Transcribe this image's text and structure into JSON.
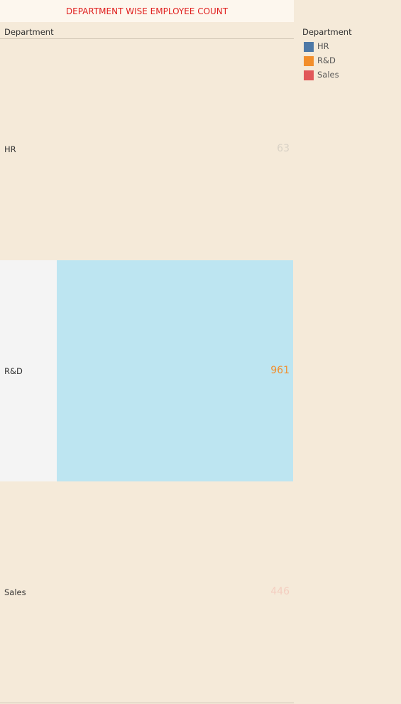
{
  "title": "DEPARTMENT WISE EMPLOYEE COUNT",
  "table": {
    "column_header": "Department",
    "rows": [
      {
        "label": "HR",
        "value": "63",
        "value_color": "#d9d2c6"
      },
      {
        "label": "R&D",
        "value": "961",
        "value_color": "#f28e2b"
      },
      {
        "label": "Sales",
        "value": "446",
        "value_color": "#f4cec0"
      }
    ],
    "selected_row": "R&D"
  },
  "legend": {
    "title": "Department",
    "items": [
      {
        "label": "HR",
        "color": "#4e79a7"
      },
      {
        "label": "R&D",
        "color": "#f28e2b"
      },
      {
        "label": "Sales",
        "color": "#e15759"
      }
    ]
  },
  "colors": {
    "background": "#f5ead9",
    "title": "#e0201f",
    "selection": "#bde5f1"
  }
}
